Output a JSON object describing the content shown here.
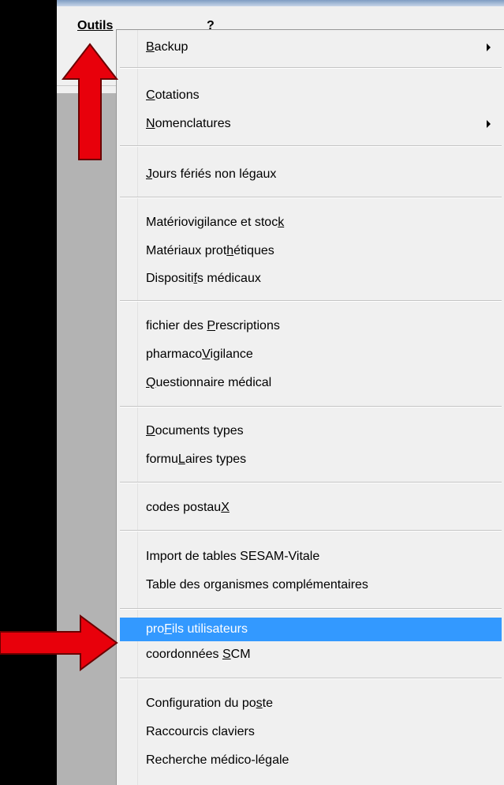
{
  "menubar": {
    "outils_label": "Outils",
    "help_label": "?"
  },
  "menu": {
    "items": [
      {
        "pre": "",
        "key": "B",
        "post": "ackup",
        "submenu": true
      },
      {
        "pre": "",
        "key": "C",
        "post": "otations"
      },
      {
        "pre": "",
        "key": "N",
        "post": "omenclatures",
        "submenu": true
      },
      {
        "pre": "",
        "key": "J",
        "post": "ours fériés non légaux"
      },
      {
        "pre": "Matériovigilance et stoc",
        "key": "k",
        "post": ""
      },
      {
        "pre": "Matériaux prot",
        "key": "h",
        "post": "étiques"
      },
      {
        "pre": "Dispositi",
        "key": "f",
        "post": "s médicaux"
      },
      {
        "pre": "fichier des ",
        "key": "P",
        "post": "rescriptions"
      },
      {
        "pre": "pharmaco",
        "key": "V",
        "post": "igilance"
      },
      {
        "pre": "",
        "key": "Q",
        "post": "uestionnaire médical"
      },
      {
        "pre": "",
        "key": "D",
        "post": "ocuments types"
      },
      {
        "pre": "formu",
        "key": "L",
        "post": "aires types"
      },
      {
        "pre": "codes postau",
        "key": "X",
        "post": ""
      },
      {
        "pre": "Import de tables SESAM-Vitale",
        "key": "",
        "post": ""
      },
      {
        "pre": "Table des organismes complémentaires",
        "key": "",
        "post": ""
      },
      {
        "pre": "pro",
        "key": "F",
        "post": "ils utilisateurs",
        "selected": true
      },
      {
        "pre": "coordonnées ",
        "key": "S",
        "post": "CM"
      },
      {
        "pre": "Configuration du po",
        "key": "s",
        "post": "te"
      },
      {
        "pre": "Raccourcis claviers",
        "key": "",
        "post": ""
      },
      {
        "pre": "Recherche médico-légale",
        "key": "",
        "post": ""
      }
    ]
  },
  "annotations": {
    "arrow_color": "#e8000b",
    "highlight_color": "#3399ff"
  }
}
